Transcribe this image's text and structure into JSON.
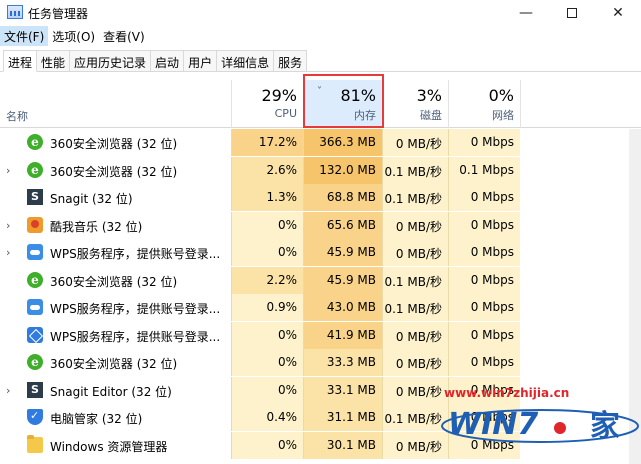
{
  "window": {
    "title": "任务管理器",
    "minimize": "—",
    "close": "✕"
  },
  "menu": [
    {
      "label": "文件(F)"
    },
    {
      "label": "选项(O)"
    },
    {
      "label": "查看(V)"
    }
  ],
  "tabs": [
    {
      "label": "进程"
    },
    {
      "label": "性能"
    },
    {
      "label": "应用历史记录"
    },
    {
      "label": "启动"
    },
    {
      "label": "用户"
    },
    {
      "label": "详细信息"
    },
    {
      "label": "服务"
    }
  ],
  "header": {
    "name_label": "名称",
    "cpu": {
      "pct": "29%",
      "label": "CPU"
    },
    "memory": {
      "pct": "81%",
      "label": "内存",
      "sort_chevron": "˅"
    },
    "disk": {
      "pct": "3%",
      "label": "磁盘"
    },
    "network": {
      "pct": "0%",
      "label": "网络"
    }
  },
  "rows": [
    {
      "name": "360安全浏览器 (32 位)",
      "icon": "browser-360-icon",
      "expandable": false,
      "cpu": "17.2%",
      "mem": "366.3 MB",
      "disk": "0 MB/秒",
      "net": "0 Mbps"
    },
    {
      "name": "360安全浏览器 (32 位)",
      "icon": "browser-360-icon",
      "expandable": true,
      "cpu": "2.6%",
      "mem": "132.0 MB",
      "disk": "0.1 MB/秒",
      "net": "0.1 Mbps"
    },
    {
      "name": "Snagit (32 位)",
      "icon": "snagit-icon",
      "expandable": false,
      "cpu": "1.3%",
      "mem": "68.8 MB",
      "disk": "0.1 MB/秒",
      "net": "0 Mbps"
    },
    {
      "name": "酷我音乐 (32 位)",
      "icon": "music-icon",
      "expandable": true,
      "cpu": "0%",
      "mem": "65.6 MB",
      "disk": "0 MB/秒",
      "net": "0 Mbps"
    },
    {
      "name": "WPS服务程序，提供账号登录...",
      "icon": "cloud-icon",
      "expandable": true,
      "cpu": "0%",
      "mem": "45.9 MB",
      "disk": "0 MB/秒",
      "net": "0 Mbps"
    },
    {
      "name": "360安全浏览器 (32 位)",
      "icon": "browser-360-icon",
      "expandable": false,
      "cpu": "2.2%",
      "mem": "45.9 MB",
      "disk": "0.1 MB/秒",
      "net": "0 Mbps"
    },
    {
      "name": "WPS服务程序，提供账号登录...",
      "icon": "cloud-icon",
      "expandable": false,
      "cpu": "0.9%",
      "mem": "43.0 MB",
      "disk": "0.1 MB/秒",
      "net": "0 Mbps"
    },
    {
      "name": "WPS服务程序，提供账号登录...",
      "icon": "cube-icon",
      "expandable": false,
      "cpu": "0%",
      "mem": "41.9 MB",
      "disk": "0 MB/秒",
      "net": "0 Mbps"
    },
    {
      "name": "360安全浏览器 (32 位)",
      "icon": "browser-360-icon",
      "expandable": false,
      "cpu": "0%",
      "mem": "33.3 MB",
      "disk": "0 MB/秒",
      "net": "0 Mbps"
    },
    {
      "name": "Snagit Editor (32 位)",
      "icon": "snagit-icon",
      "expandable": true,
      "cpu": "0%",
      "mem": "33.1 MB",
      "disk": "0 MB/秒",
      "net": "0 Mbps"
    },
    {
      "name": "电脑管家 (32 位)",
      "icon": "shield-icon",
      "expandable": false,
      "cpu": "0.4%",
      "mem": "31.1 MB",
      "disk": "0.1 MB/秒",
      "net": "0 Mbps"
    },
    {
      "name": "Windows 资源管理器",
      "icon": "folder-icon",
      "expandable": false,
      "cpu": "0%",
      "mem": "30.1 MB",
      "disk": "0 MB/秒",
      "net": "0 Mbps"
    }
  ],
  "colors": {
    "cpu_hot": "#f9d38a",
    "cpu_warm": "#fbe3a8",
    "cell_bg": "#fdf2cc",
    "mem_hot": "#f6c46a",
    "highlight": "#e53b3b"
  },
  "watermark": {
    "url": "www.win7zhijia.cn",
    "logo_text": "WIN7",
    "logo_suffix": "家"
  }
}
